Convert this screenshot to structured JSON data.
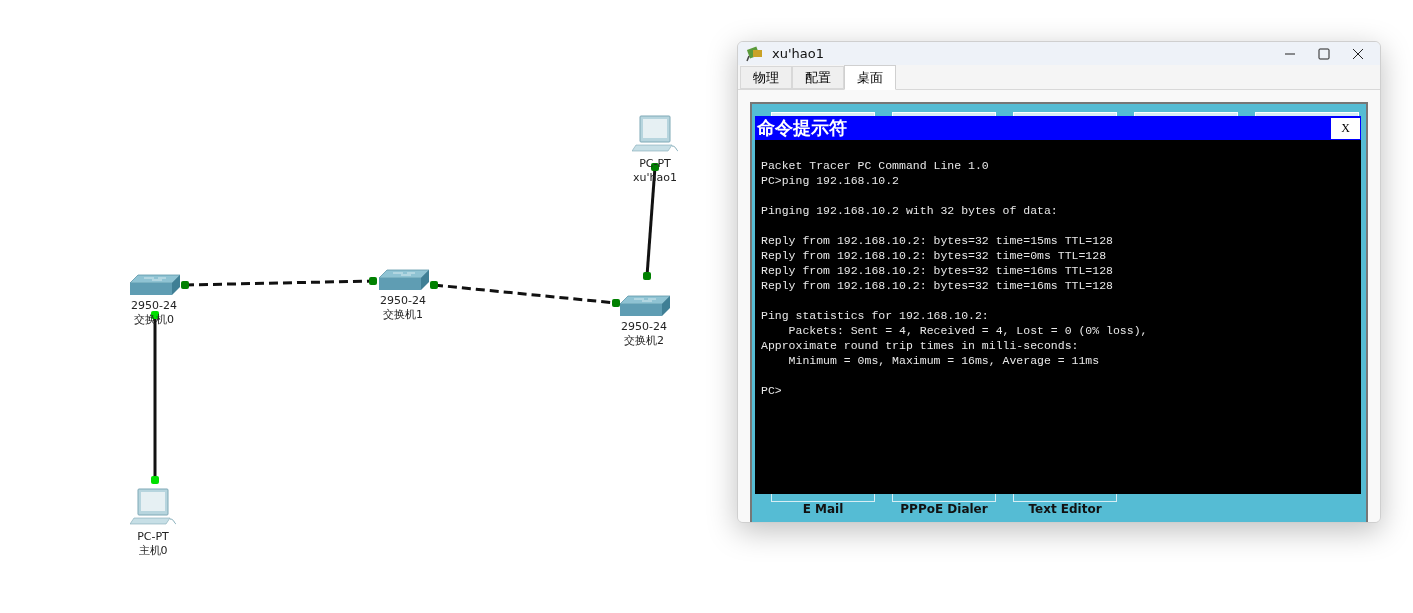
{
  "topology": {
    "devices": [
      {
        "kind": "pc",
        "model": "PC-PT",
        "name": "xu'hao1"
      },
      {
        "kind": "switch",
        "model": "2950-24",
        "name": "交换机0"
      },
      {
        "kind": "switch",
        "model": "2950-24",
        "name": "交换机1"
      },
      {
        "kind": "switch",
        "model": "2950-24",
        "name": "交换机2"
      },
      {
        "kind": "pc",
        "model": "PC-PT",
        "name": "主机0"
      }
    ],
    "links": [
      {
        "kind": "dashed",
        "color": "#008000"
      },
      {
        "kind": "dashed",
        "color": "#008000"
      },
      {
        "kind": "solid",
        "color": "#008000"
      },
      {
        "kind": "solid",
        "color": "#00e000"
      }
    ]
  },
  "window": {
    "title": "xu'hao1",
    "tabs": [
      {
        "label": "物理",
        "selected": false
      },
      {
        "label": "配置",
        "selected": false
      },
      {
        "label": "桌面",
        "selected": true
      }
    ],
    "desktop_apps": [
      {
        "label": "E Mail"
      },
      {
        "label": "PPPoE Dialer"
      },
      {
        "label": "Text Editor"
      }
    ],
    "command_prompt": {
      "title": "命令提示符",
      "close": "X",
      "blocks": [
        [
          "Packet Tracer PC Command Line 1.0",
          "PC>ping 192.168.10.2"
        ],
        [
          "Pinging 192.168.10.2 with 32 bytes of data:"
        ],
        [
          "Reply from 192.168.10.2: bytes=32 time=15ms TTL=128",
          "Reply from 192.168.10.2: bytes=32 time=0ms TTL=128",
          "Reply from 192.168.10.2: bytes=32 time=16ms TTL=128",
          "Reply from 192.168.10.2: bytes=32 time=16ms TTL=128"
        ],
        [
          "Ping statistics for 192.168.10.2:",
          "    Packets: Sent = 4, Received = 4, Lost = 0 (0% loss),",
          "Approximate round trip times in milli-seconds:",
          "    Minimum = 0ms, Maximum = 16ms, Average = 11ms"
        ],
        [
          "PC>"
        ]
      ]
    }
  }
}
